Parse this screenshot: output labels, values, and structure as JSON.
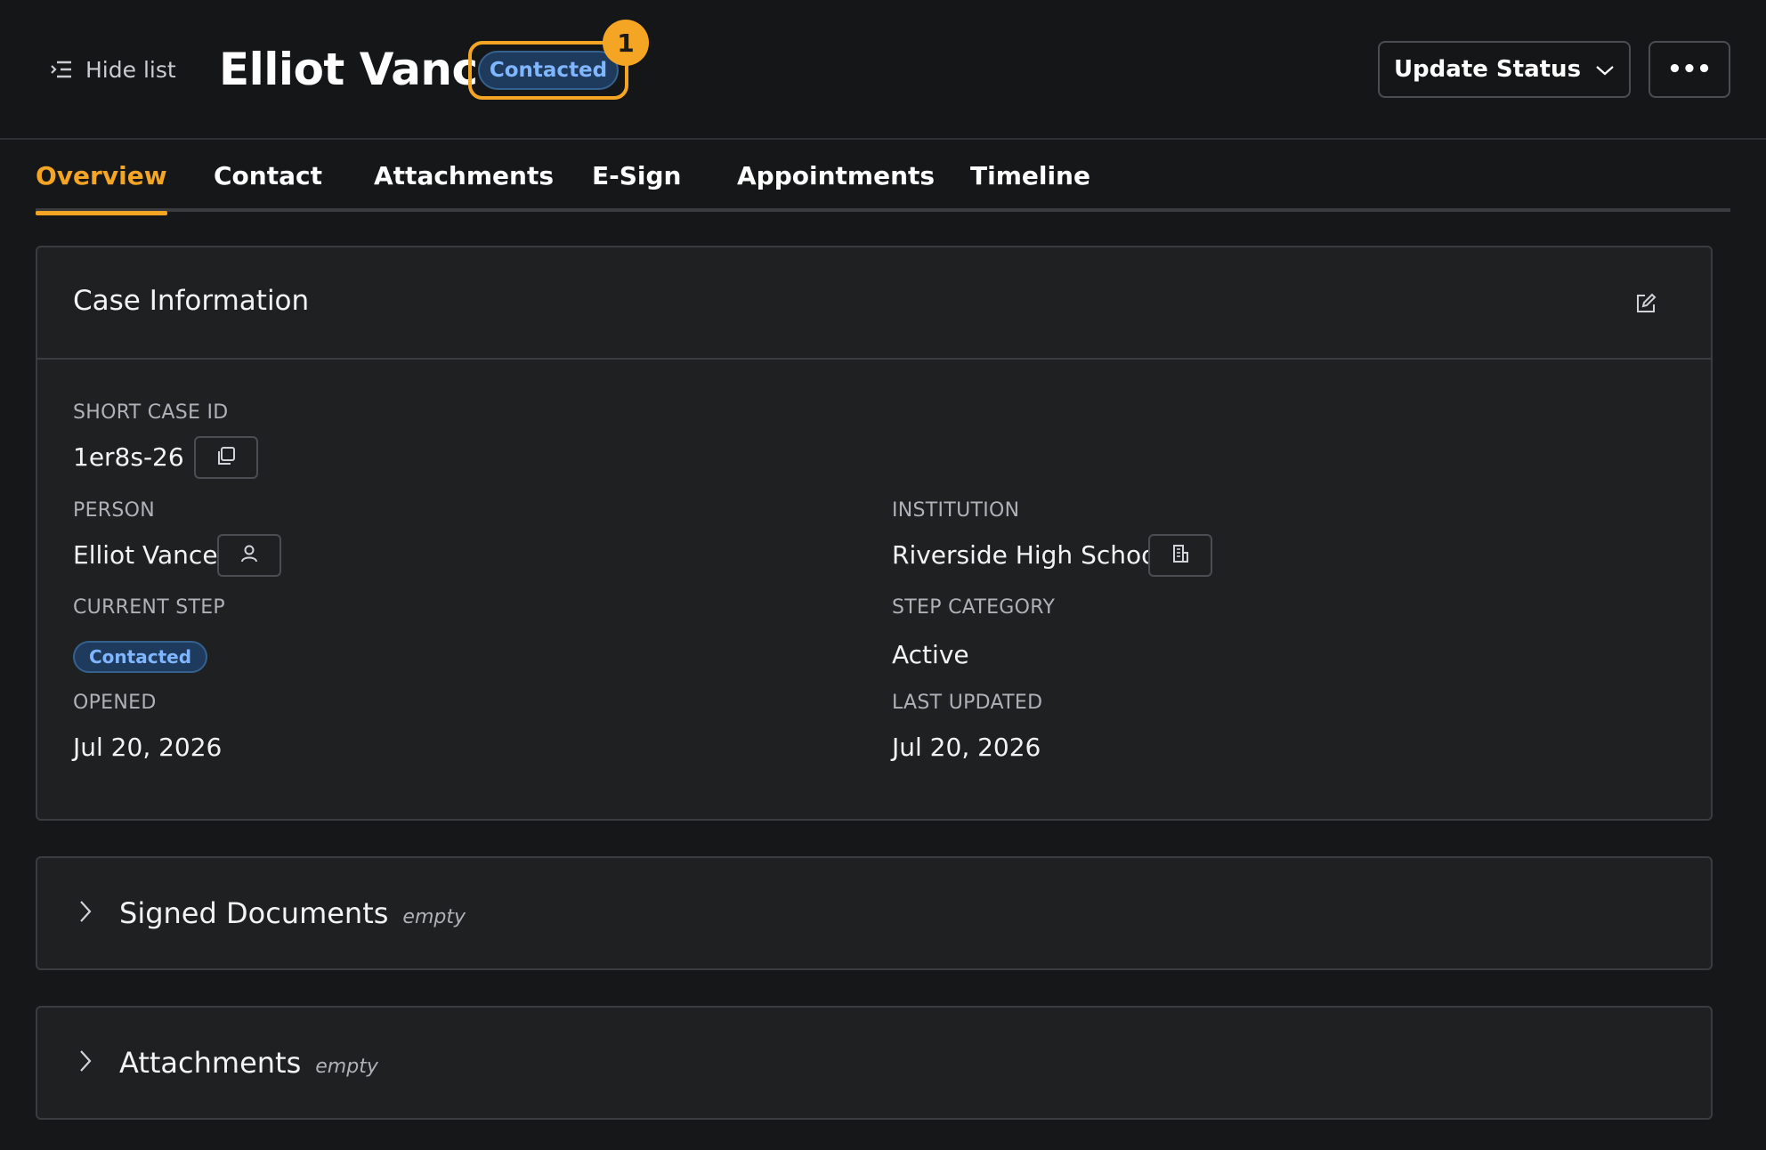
{
  "header": {
    "hide_list_label": "Hide list",
    "title": "Elliot Vance",
    "status": "Contacted",
    "notification_count": "1",
    "update_status_label": "Update Status",
    "more_label": "•••"
  },
  "tabs": [
    {
      "label": "Overview",
      "active": true
    },
    {
      "label": "Contact",
      "active": false
    },
    {
      "label": "Attachments",
      "active": false
    },
    {
      "label": "E-Sign",
      "active": false
    },
    {
      "label": "Appointments",
      "active": false
    },
    {
      "label": "Timeline",
      "active": false
    }
  ],
  "case_info": {
    "title": "Case Information",
    "short_case_id_label": "SHORT CASE ID",
    "short_case_id": "1er8s-26",
    "person_label": "PERSON",
    "person": "Elliot Vance",
    "institution_label": "INSTITUTION",
    "institution": "Riverside High School",
    "current_step_label": "CURRENT STEP",
    "current_step": "Contacted",
    "step_category_label": "STEP CATEGORY",
    "step_category": "Active",
    "opened_label": "OPENED",
    "opened": "Jul 20, 2026",
    "last_updated_label": "LAST UPDATED",
    "last_updated": "Jul 20, 2026"
  },
  "sections": [
    {
      "title": "Signed Documents",
      "note": "empty"
    },
    {
      "title": "Attachments",
      "note": "empty"
    }
  ],
  "colors": {
    "accent": "#f5a524",
    "status_blue": "#7fb6ff",
    "background": "#161718",
    "card": "#1f2022"
  },
  "icons": {
    "hide_list": "list-indent-icon",
    "update_status": "chevron-down-icon",
    "edit": "edit-icon",
    "copy": "copy-icon",
    "person": "person-icon",
    "institution": "building-icon",
    "section_toggle": "chevron-right-icon"
  }
}
